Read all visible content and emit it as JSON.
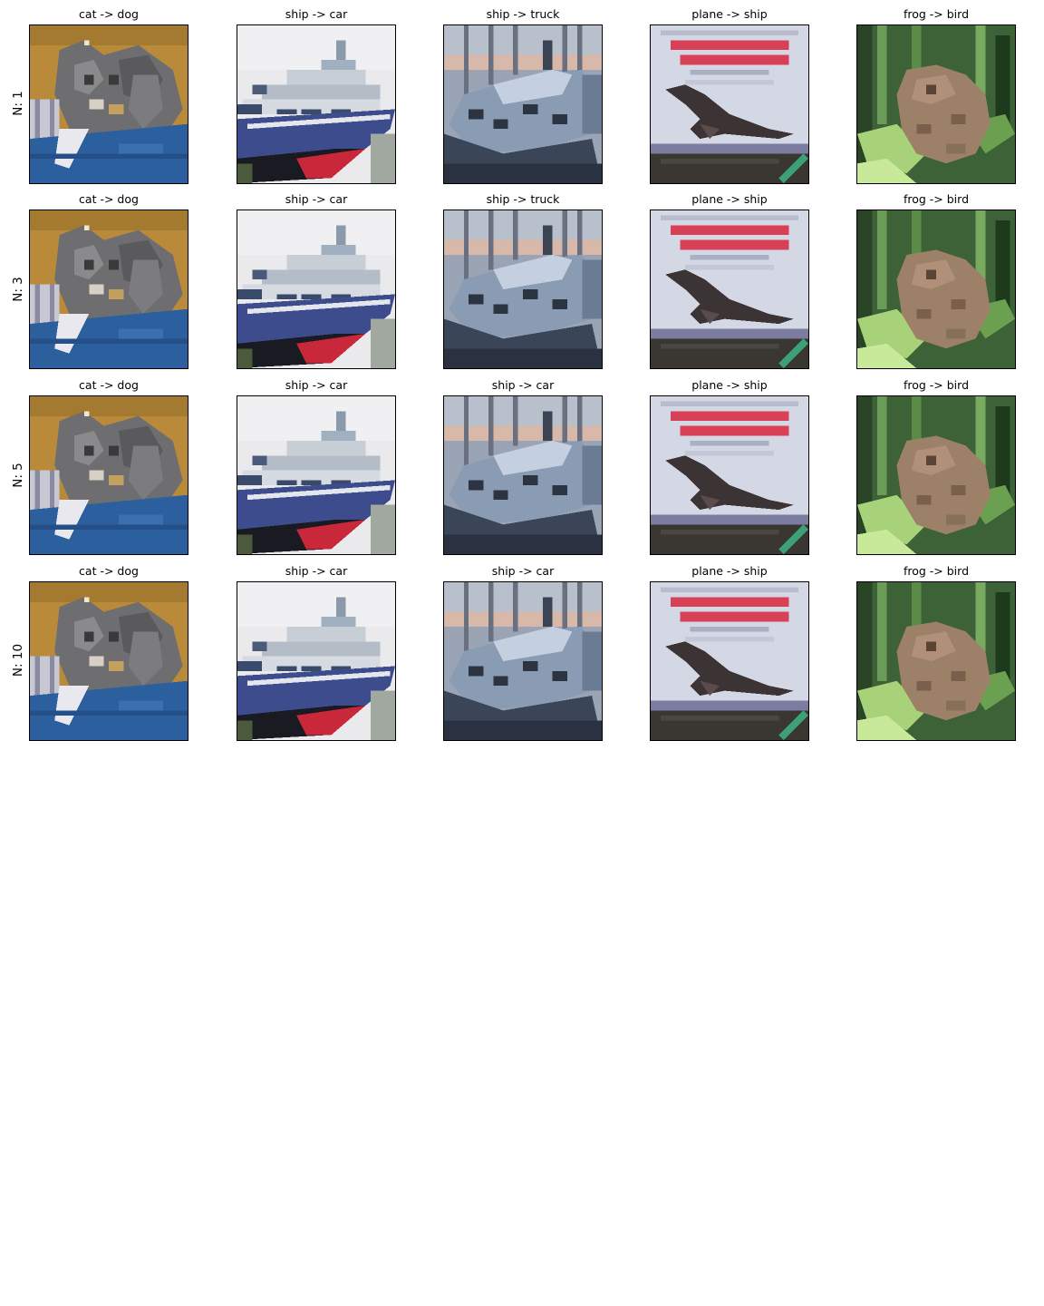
{
  "rows": [
    {
      "label": "N: 1",
      "cells": [
        {
          "title": "cat -> dog",
          "subject": "cat"
        },
        {
          "title": "ship -> car",
          "subject": "ship-white"
        },
        {
          "title": "ship -> truck",
          "subject": "ship-harbor"
        },
        {
          "title": "plane -> ship",
          "subject": "plane"
        },
        {
          "title": "frog -> bird",
          "subject": "frog"
        }
      ]
    },
    {
      "label": "N: 3",
      "cells": [
        {
          "title": "cat -> dog",
          "subject": "cat"
        },
        {
          "title": "ship -> car",
          "subject": "ship-white"
        },
        {
          "title": "ship -> truck",
          "subject": "ship-harbor"
        },
        {
          "title": "plane -> ship",
          "subject": "plane"
        },
        {
          "title": "frog -> bird",
          "subject": "frog"
        }
      ]
    },
    {
      "label": "N: 5",
      "cells": [
        {
          "title": "cat -> dog",
          "subject": "cat"
        },
        {
          "title": "ship -> car",
          "subject": "ship-white"
        },
        {
          "title": "ship -> car",
          "subject": "ship-harbor"
        },
        {
          "title": "plane -> ship",
          "subject": "plane"
        },
        {
          "title": "frog -> bird",
          "subject": "frog"
        }
      ]
    },
    {
      "label": "N: 10",
      "cells": [
        {
          "title": "cat -> dog",
          "subject": "cat"
        },
        {
          "title": "ship -> car",
          "subject": "ship-white"
        },
        {
          "title": "ship -> car",
          "subject": "ship-harbor"
        },
        {
          "title": "plane -> ship",
          "subject": "plane"
        },
        {
          "title": "frog -> bird",
          "subject": "frog"
        }
      ]
    }
  ]
}
